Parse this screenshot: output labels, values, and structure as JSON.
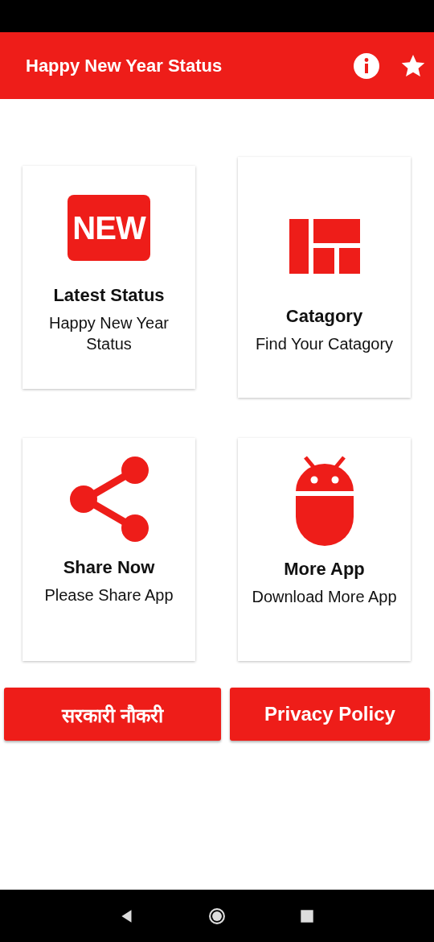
{
  "app_bar": {
    "title": "Happy New Year Status"
  },
  "cards": [
    {
      "kind": "new",
      "badge": "NEW",
      "title": "Latest Status",
      "subtitle": "Happy New Year Status"
    },
    {
      "kind": "grid",
      "title": "Catagory",
      "subtitle": "Find Your Catagory"
    },
    {
      "kind": "share",
      "title": "Share Now",
      "subtitle": "Please Share App"
    },
    {
      "kind": "android",
      "title": "More App",
      "subtitle": "Download More App"
    }
  ],
  "buttons": [
    "सरकारी नौकरी",
    "Privacy Policy"
  ]
}
